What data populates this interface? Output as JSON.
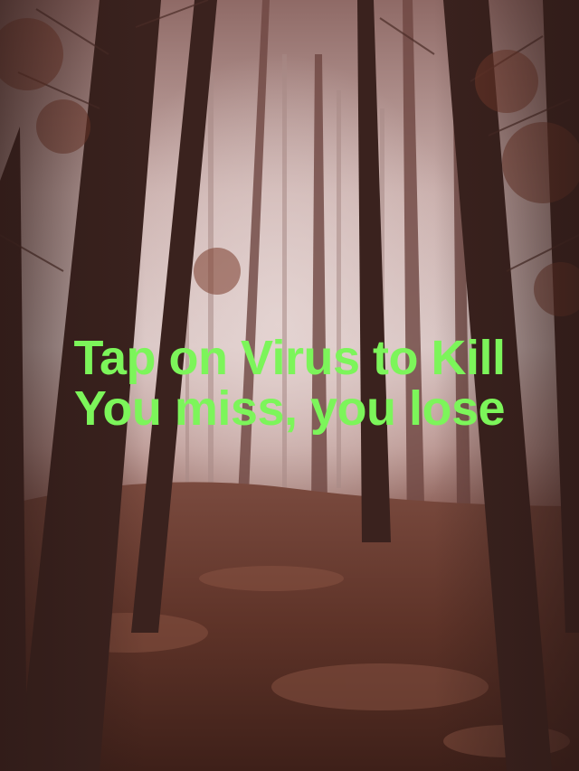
{
  "game": {
    "instruction_line1": "Tap on Virus to Kill",
    "instruction_line2": "You miss, you lose"
  },
  "colors": {
    "instruction_text": "#7cf55a",
    "fog": "#d9c6c4",
    "forest_floor": "#5a3026"
  },
  "background": {
    "scene": "foggy-forest"
  }
}
